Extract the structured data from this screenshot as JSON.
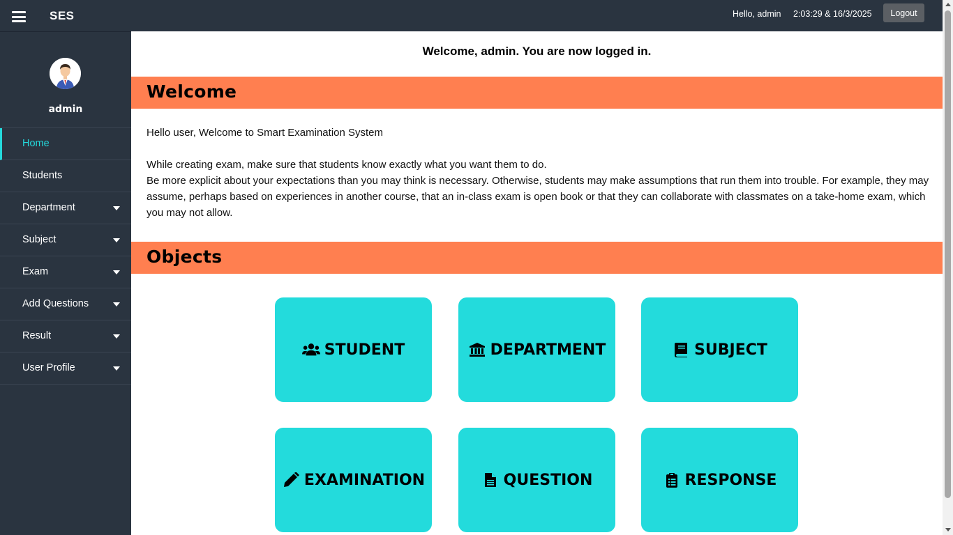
{
  "header": {
    "brand": "SES",
    "greeting": "Hello, admin",
    "clock": "2:03:29 & 16/3/2025",
    "logout_label": "Logout"
  },
  "sidebar": {
    "profile_name": "admin",
    "items": [
      {
        "label": "Home",
        "active": true,
        "has_dropdown": false
      },
      {
        "label": "Students",
        "active": false,
        "has_dropdown": false
      },
      {
        "label": "Department",
        "active": false,
        "has_dropdown": true
      },
      {
        "label": "Subject",
        "active": false,
        "has_dropdown": true
      },
      {
        "label": "Exam",
        "active": false,
        "has_dropdown": true
      },
      {
        "label": "Add Questions",
        "active": false,
        "has_dropdown": true
      },
      {
        "label": "Result",
        "active": false,
        "has_dropdown": true
      },
      {
        "label": "User Profile",
        "active": false,
        "has_dropdown": true
      }
    ]
  },
  "main": {
    "login_message": "Welcome, admin. You are now logged in.",
    "welcome_title": "Welcome",
    "intro": "Hello user, Welcome to Smart Examination System",
    "paragraph_1": "While creating exam, make sure that students know exactly what you want them to do.",
    "paragraph_2": "Be more explicit about your expectations than you may think is necessary. Otherwise, students may make assumptions that run them into trouble. For example, they may assume, perhaps based on experiences in another course, that an in-class exam is open book or that they can collaborate with classmates on a take-home exam, which you may not allow.",
    "objects_title": "Objects",
    "cards": [
      {
        "label": "STUDENT",
        "icon": "users-icon"
      },
      {
        "label": "DEPARTMENT",
        "icon": "bank-icon"
      },
      {
        "label": "SUBJECT",
        "icon": "book-icon"
      },
      {
        "label": "EXAMINATION",
        "icon": "pencil-icon"
      },
      {
        "label": "QUESTION",
        "icon": "file-icon"
      },
      {
        "label": "RESPONSE",
        "icon": "clipboard-icon"
      }
    ]
  },
  "colors": {
    "dark_bg": "#2a3440",
    "accent": "#24d9dc",
    "section_bar": "#ff7f50",
    "card": "#23dbdc"
  }
}
